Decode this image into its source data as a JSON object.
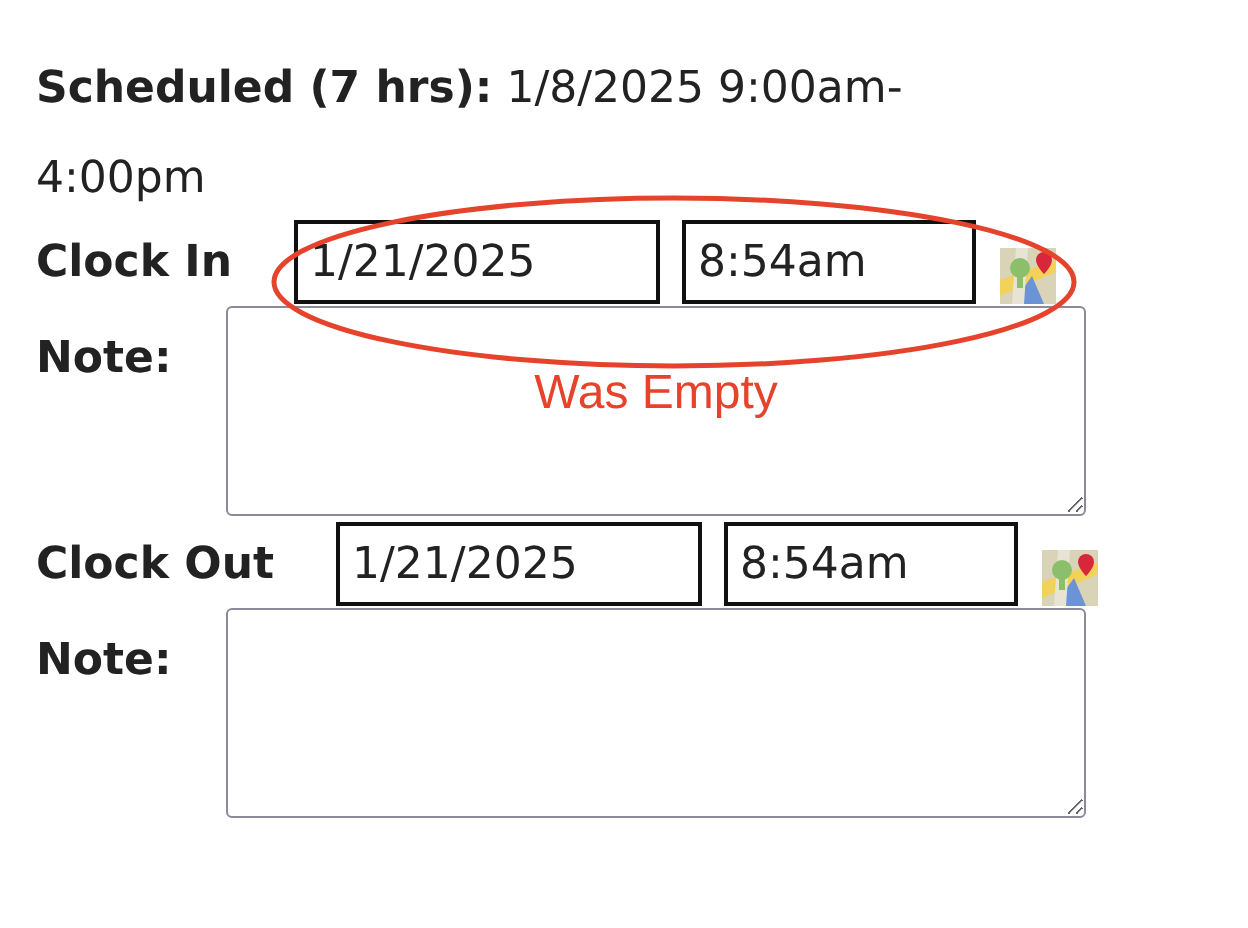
{
  "schedule": {
    "text": "**Scheduled (7 hrs):** 1/8/2025 9:00am-4:00pm"
  },
  "entries": [
    {
      "label": "Clock In",
      "date": "1/21/2025",
      "time": "8:54am",
      "note_label": "Note:",
      "circled": true,
      "annotation": "Was Empty"
    },
    {
      "label": "Clock Out",
      "date": "1/21/2025",
      "time": "8:54am",
      "note_label": "Note:",
      "circled": false
    }
  ]
}
